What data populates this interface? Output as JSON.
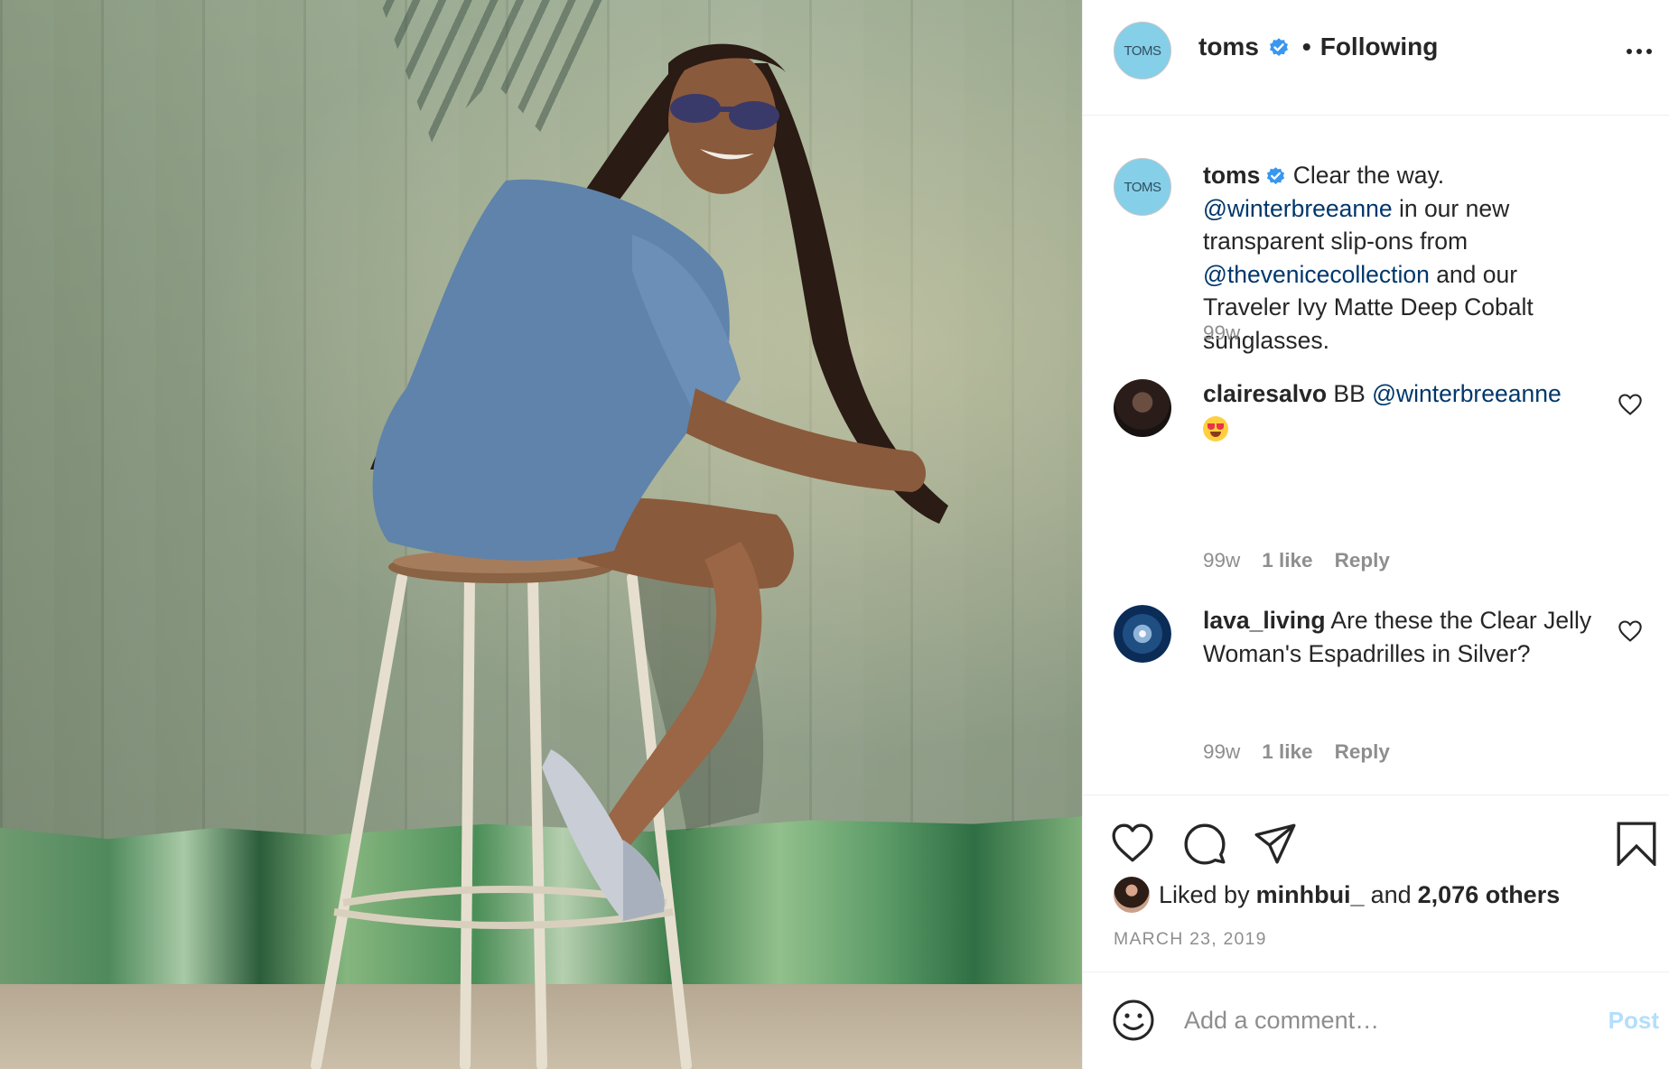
{
  "header": {
    "avatar_text": "TOMS",
    "username": "toms",
    "separator": "•",
    "follow_state": "Following"
  },
  "caption": {
    "avatar_text": "TOMS",
    "username": "toms",
    "text_1": " Clear the way. ",
    "mention_1": "@winterbreeanne",
    "text_2": " in our new transparent slip-ons from ",
    "mention_2": "@thevenicecollection",
    "text_3": " and our Traveler Ivy Matte Deep Cobalt sunglasses.",
    "time": "99w"
  },
  "comments": [
    {
      "username": "clairesalvo",
      "text": " BB ",
      "mention": "@winterbreeanne",
      "emoji": "heart-eyes-emoji",
      "time": "99w",
      "likes": "1 like",
      "reply": "Reply"
    },
    {
      "username": "lava_living",
      "text": " Are these the Clear Jelly Woman's Espadrilles in Silver?",
      "time": "99w",
      "likes": "1 like",
      "reply": "Reply"
    }
  ],
  "actions": {
    "icons": [
      "heart-icon",
      "comment-icon",
      "share-icon",
      "bookmark-icon"
    ]
  },
  "likes": {
    "prefix": "Liked by ",
    "liker": "minhbui_",
    "middle": " and ",
    "others": "2,076 others"
  },
  "date": "MARCH 23, 2019",
  "add_comment": {
    "placeholder": "Add a comment…",
    "post_label": "Post"
  },
  "colors": {
    "mention": "#00376b",
    "verified": "#3897f0",
    "post_disabled": "#b2dffc",
    "secondary_text": "#8e8e8e",
    "toms_avatar": "#86cfe9"
  }
}
